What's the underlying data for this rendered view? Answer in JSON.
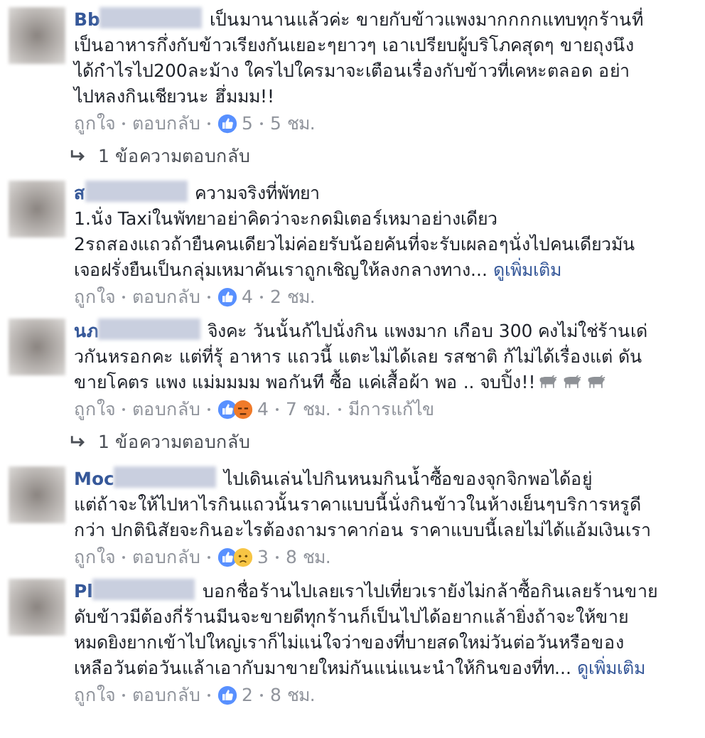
{
  "comments": [
    {
      "author": "Bb",
      "text": "เป็นมานานแล้วค่ะ ขายกับข้าวแพงมากกกกแทบทุกร้านที่\nเป็นอาหารกึ่งกับข้าวเรียงกันเยอะๆยาวๆ เอาเปรียบผู้บริโภคสุดๆ ขายถุงนึง\nได้กำไรไป200ละม้าง ใครไปใครมาจะเตือนเรื่องกับข้าวที่เคหะตลอด อย่า\nไปหลงกินเชียวนะ ฮึ่มมม!!",
      "like_label": "ถูกใจ",
      "reply_label": "ตอบกลับ",
      "reactions": [
        {
          "kind": "like"
        }
      ],
      "reaction_count": "5",
      "time": "5 ชม.",
      "replies": "1 ข้อความตอบกลับ"
    },
    {
      "author": "ส",
      "text": "ความจริงที่พัทยา\n1.นั่ง Taxiในพัทยาอย่าคิดว่าจะกดมิเตอร์เหมาอย่างเดียว\n2รถสองแถวถ้ายืนคนเดียวไม่ค่อยรับน้อยคันที่จะรับเผลอๆนั่งไปคนเดียวมัน\nเจอฝรั่งยืนเป็นกลุ่มเหมาคันเราถูกเชิญให้ลงกลางทาง...",
      "see_more": "ดูเพิ่มเติม",
      "like_label": "ถูกใจ",
      "reply_label": "ตอบกลับ",
      "reactions": [
        {
          "kind": "like"
        }
      ],
      "reaction_count": "4",
      "time": "2 ชม."
    },
    {
      "author": "นภ",
      "text": "จิงคะ วันนั้นก้ไปนั่งกิน แพงมาก เกือบ 300 คงไม่ใช่ร้านเด่\nวกันหรอกคะ แต่ที่รุ้ อาหาร แถวนี้ แตะไม่ได้เลย รสชาติ ก้ไม่ได้เรื่องแต่ ดัน\nขายโคตร แพง แม่มมมม พอกันที ซื้อ แค่เสื้อผ้า พอ .. จบปิ้ง!!",
      "emoji": [
        {
          "kind": "buffalo"
        },
        {
          "kind": "buffalo"
        },
        {
          "kind": "buffalo"
        }
      ],
      "like_label": "ถูกใจ",
      "reply_label": "ตอบกลับ",
      "reactions": [
        {
          "kind": "like"
        },
        {
          "kind": "angry"
        }
      ],
      "reaction_count": "4",
      "time": "7 ชม.",
      "edited": "มีการแก้ไข",
      "replies": "1 ข้อความตอบกลับ"
    },
    {
      "author": "Moc",
      "text": "ไปเดินเล่นไปกินหนมกินน้ำซื้อของจุกจิกพอได้อยู่\nแต่ถ้าจะให้ไปหาไรกินแถวนั้นราคาแบบนี้นั่งกินข้าวในห้างเย็นๆบริการหรูดี\nกว่า ปกตินิสัยจะกินอะไรต้องถามราคาก่อน ราคาแบบนี้เลยไม่ได้แอ้มเงินเรา",
      "like_label": "ถูกใจ",
      "reply_label": "ตอบกลับ",
      "reactions": [
        {
          "kind": "like"
        },
        {
          "kind": "sad"
        }
      ],
      "reaction_count": "3",
      "time": "8 ชม."
    },
    {
      "author": "Pl",
      "text": "บอกชื่อร้านไปเลยเราไปเที่ยวเรายังไม่กล้าซื้อกินเลยร้านขาย\nดับข้าวมีต้องกี่ร้านมีนจะขายดีทุกร้านก็เป็นไปได้อยากแล้ายิ่งถ้าจะให้ขาย\nหมดยิงยากเข้าไปใหญ่เราก็ไม่แน่ใจว่าของที่บายสดใหม่วันต่อวันหรือของ\nเหลือวันต่อวันแล้าเอากับมาขายใหม่กันแน่แนะนำให้กินของที่ท...",
      "see_more": "ดูเพิ่มเติม",
      "like_label": "ถูกใจ",
      "reply_label": "ตอบกลับ",
      "reactions": [
        {
          "kind": "like"
        }
      ],
      "reaction_count": "2",
      "time": "8 ชม."
    }
  ]
}
